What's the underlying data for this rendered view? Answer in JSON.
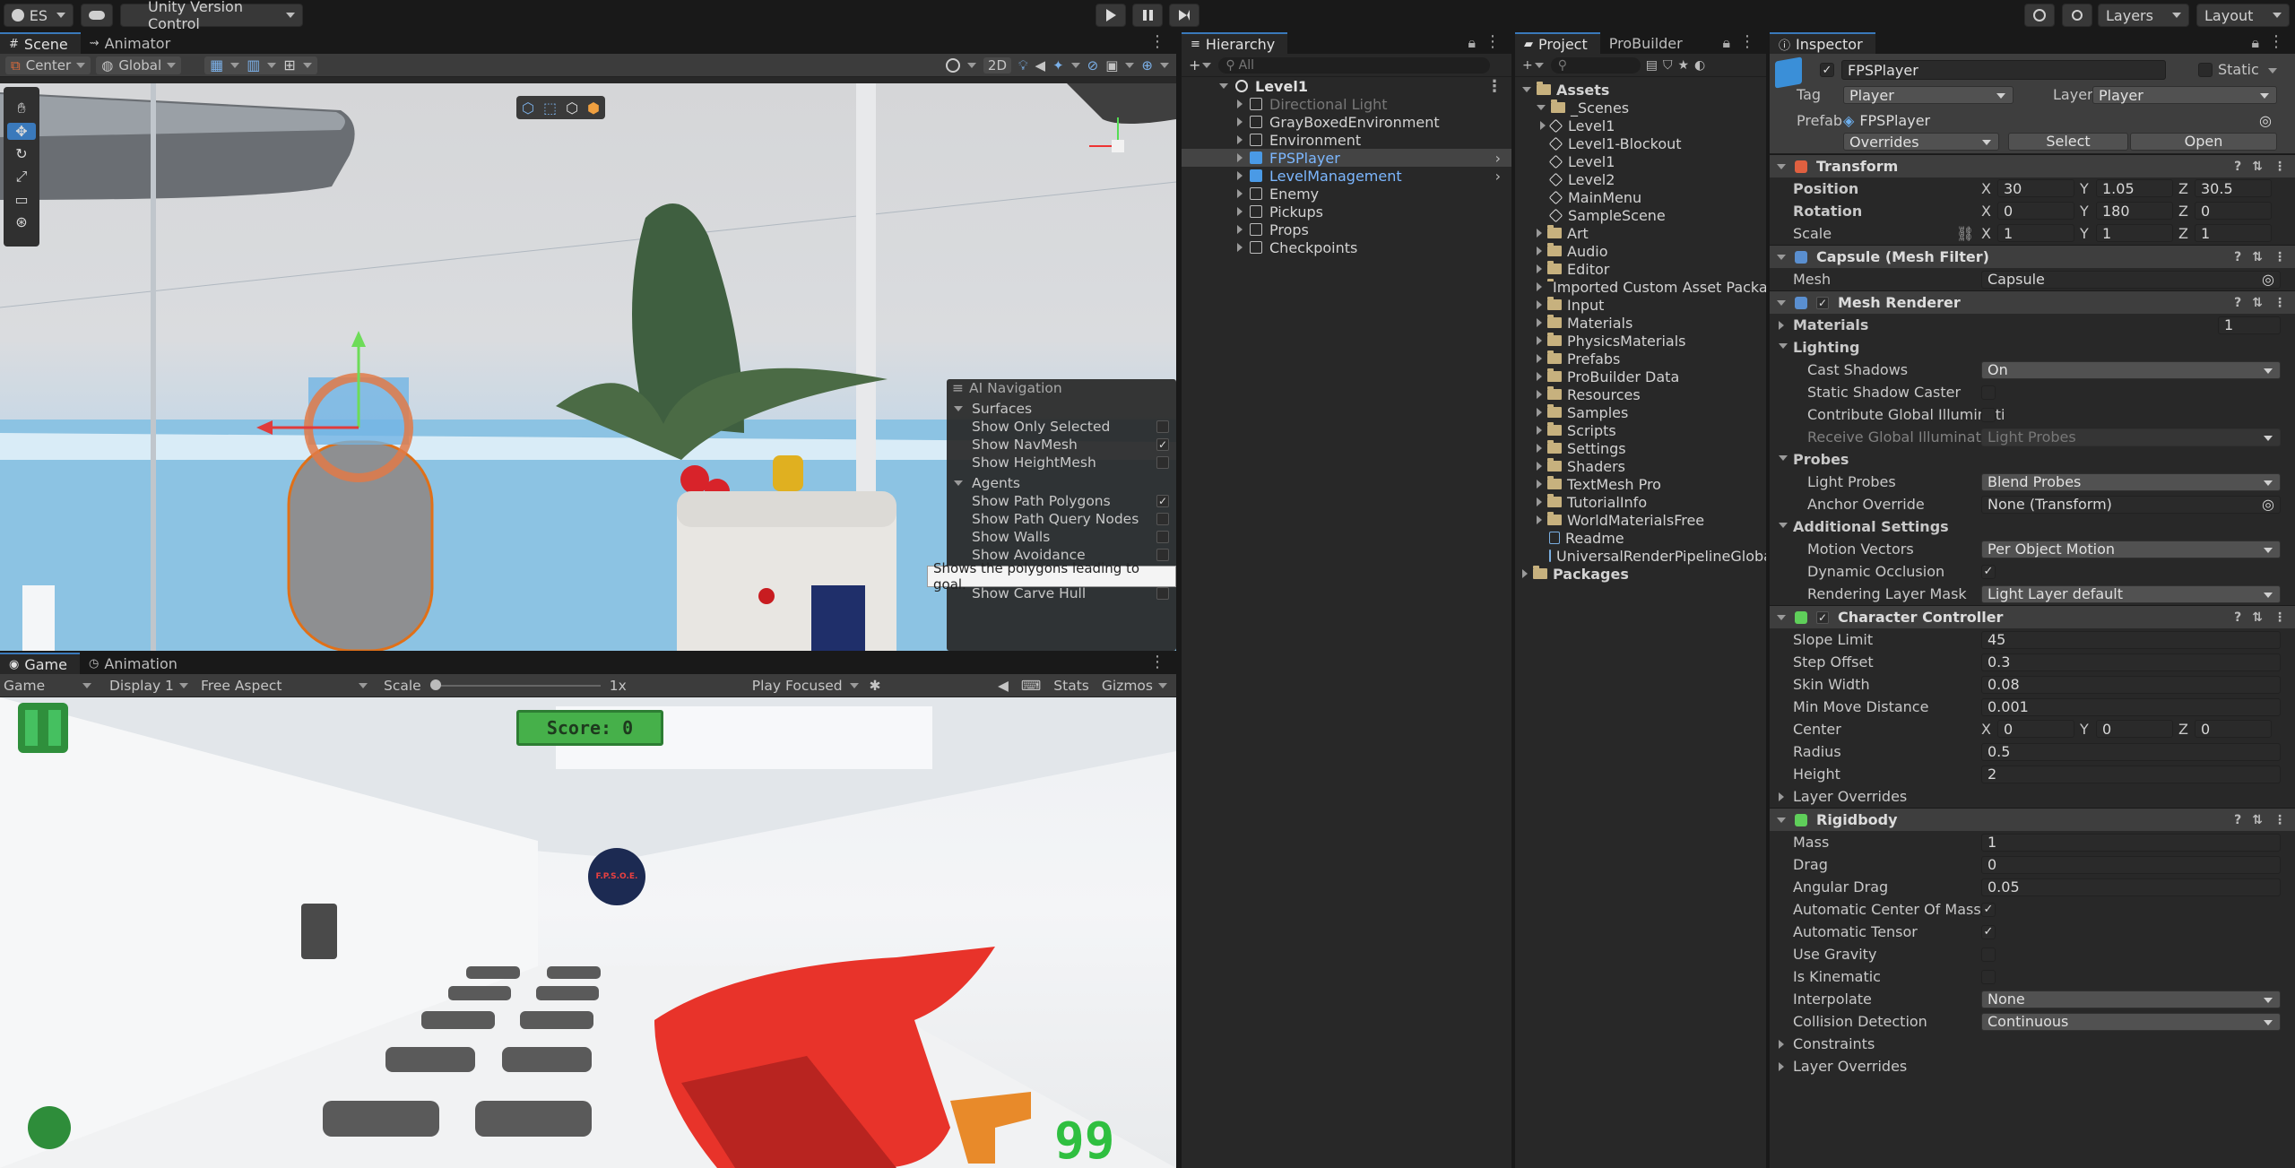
{
  "topbar": {
    "account": "ES",
    "version_control": "Unity Version Control",
    "layers": "Layers",
    "layout": "Layout"
  },
  "scene": {
    "tabs": [
      {
        "label": "Scene"
      },
      {
        "label": "Animator"
      }
    ],
    "pivot": "Center",
    "space": "Global",
    "mode_2d": "2D",
    "ai_nav": {
      "title": "AI Navigation",
      "sections": [
        {
          "label": "Surfaces",
          "items": [
            {
              "label": "Show Only Selected",
              "checked": false
            },
            {
              "label": "Show NavMesh",
              "checked": true
            },
            {
              "label": "Show HeightMesh",
              "checked": false
            }
          ]
        },
        {
          "label": "Agents",
          "items": [
            {
              "label": "Show Path Polygons",
              "checked": true
            },
            {
              "label": "Show Path Query Nodes",
              "checked": false
            },
            {
              "label": "Show Walls",
              "checked": false
            },
            {
              "label": "Show Avoidance",
              "checked": false
            }
          ]
        },
        {
          "label": "Obstacles",
          "items": [
            {
              "label": "Show Carve Hull",
              "checked": false
            }
          ]
        }
      ],
      "tooltip": "Shows the polygons leading to goal."
    }
  },
  "game": {
    "tabs": [
      {
        "label": "Game"
      },
      {
        "label": "Animation"
      }
    ],
    "mode": "Game",
    "display": "Display 1",
    "aspect": "Free Aspect",
    "scale_label": "Scale",
    "scale_value": "1x",
    "play_focus": "Play Focused",
    "stats": "Stats",
    "gizmos": "Gizmos",
    "score": "Score: 0",
    "ammo": "99",
    "logo_text": "F.P.S.O.E."
  },
  "hierarchy": {
    "tab": "Hierarchy",
    "search_placeholder": "All",
    "root": "Level1",
    "items": [
      {
        "label": "Directional Light",
        "disabled": true,
        "prefab": false
      },
      {
        "label": "GrayBoxedEnvironment",
        "prefab": false
      },
      {
        "label": "Environment",
        "prefab": false
      },
      {
        "label": "FPSPlayer",
        "prefab": true,
        "selected": true
      },
      {
        "label": "LevelManagement",
        "prefab": true
      },
      {
        "label": "Enemy",
        "prefab": false
      },
      {
        "label": "Pickups",
        "prefab": false
      },
      {
        "label": "Props",
        "prefab": false
      },
      {
        "label": "Checkpoints",
        "prefab": false
      }
    ]
  },
  "project": {
    "tabs": [
      {
        "label": "Project"
      },
      {
        "label": "ProBuilder"
      }
    ],
    "root": "Assets",
    "scenes_label": "_Scenes",
    "scene_items": [
      "Level1",
      "Level1-Blockout",
      "Level1",
      "Level2",
      "MainMenu",
      "SampleScene"
    ],
    "folders": [
      "Art",
      "Audio",
      "Editor",
      "Imported Custom Asset Packag",
      "Input",
      "Materials",
      "PhysicsMaterials",
      "Prefabs",
      "ProBuilder Data",
      "Resources",
      "Samples",
      "Scripts",
      "Settings",
      "Shaders",
      "TextMesh Pro",
      "TutorialInfo",
      "WorldMaterialsFree"
    ],
    "files": [
      "Readme",
      "UniversalRenderPipelineGlobal"
    ],
    "packages": "Packages"
  },
  "inspector": {
    "tab": "Inspector",
    "object_name": "FPSPlayer",
    "static_label": "Static",
    "tag_label": "Tag",
    "tag": "Player",
    "layer_label": "Layer",
    "layer": "Player",
    "prefab_label": "Prefab",
    "prefab": "FPSPlayer",
    "overrides": "Overrides",
    "select": "Select",
    "open": "Open",
    "transform": {
      "title": "Transform",
      "position_label": "Position",
      "rotation_label": "Rotation",
      "scale_label": "Scale",
      "position": {
        "x": "30",
        "y": "1.05",
        "z": "30.5"
      },
      "rotation": {
        "x": "0",
        "y": "180",
        "z": "0"
      },
      "scale": {
        "x": "1",
        "y": "1",
        "z": "1"
      }
    },
    "mesh_filter": {
      "title": "Capsule (Mesh Filter)",
      "mesh_label": "Mesh",
      "mesh": "Capsule"
    },
    "mesh_renderer": {
      "title": "Mesh Renderer",
      "materials_label": "Materials",
      "materials_count": "1",
      "lighting_label": "Lighting",
      "cast_shadows_label": "Cast Shadows",
      "cast_shadows": "On",
      "static_shadow_label": "Static Shadow Caster",
      "contribute_gi_label": "Contribute Global Illuminati",
      "receive_gi_label": "Receive Global Illumination",
      "receive_gi": "Light Probes",
      "probes_label": "Probes",
      "light_probes_label": "Light Probes",
      "light_probes": "Blend Probes",
      "anchor_label": "Anchor Override",
      "anchor": "None (Transform)",
      "additional_label": "Additional Settings",
      "motion_vectors_label": "Motion Vectors",
      "motion_vectors": "Per Object Motion",
      "dynamic_occlusion_label": "Dynamic Occlusion",
      "rendering_layer_label": "Rendering Layer Mask",
      "rendering_layer": "Light Layer default"
    },
    "character_controller": {
      "title": "Character Controller",
      "fields": [
        {
          "label": "Slope Limit",
          "value": "45"
        },
        {
          "label": "Step Offset",
          "value": "0.3"
        },
        {
          "label": "Skin Width",
          "value": "0.08"
        },
        {
          "label": "Min Move Distance",
          "value": "0.001"
        }
      ],
      "center_label": "Center",
      "center": {
        "x": "0",
        "y": "0",
        "z": "0"
      },
      "radius_label": "Radius",
      "radius": "0.5",
      "height_label": "Height",
      "height": "2",
      "layer_overrides": "Layer Overrides"
    },
    "rigidbody": {
      "title": "Rigidbody",
      "fields": [
        {
          "label": "Mass",
          "value": "1"
        },
        {
          "label": "Drag",
          "value": "0"
        },
        {
          "label": "Angular Drag",
          "value": "0.05"
        }
      ],
      "checks": [
        {
          "label": "Automatic Center Of Mass",
          "checked": true
        },
        {
          "label": "Automatic Tensor",
          "checked": true
        },
        {
          "label": "Use Gravity",
          "checked": false
        },
        {
          "label": "Is Kinematic",
          "checked": false
        }
      ],
      "interpolate_label": "Interpolate",
      "interpolate": "None",
      "collision_label": "Collision Detection",
      "collision": "Continuous",
      "constraints": "Constraints",
      "layer_overrides": "Layer Overrides"
    }
  },
  "colors": {
    "accent": "#3a79bb",
    "panel": "#282828",
    "selection": "#444444",
    "prefab_blue": "#7cb7ff",
    "score_green": "#4caf50",
    "gun_red": "#e8332a"
  }
}
